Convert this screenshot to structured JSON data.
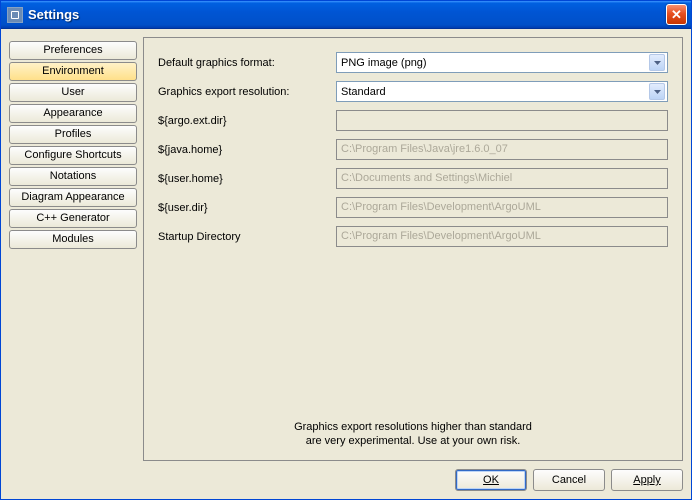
{
  "window": {
    "title": "Settings",
    "close_label": "X"
  },
  "sidebar": {
    "items": [
      {
        "label": "Preferences",
        "selected": false
      },
      {
        "label": "Environment",
        "selected": true
      },
      {
        "label": "User",
        "selected": false
      },
      {
        "label": "Appearance",
        "selected": false
      },
      {
        "label": "Profiles",
        "selected": false
      },
      {
        "label": "Configure Shortcuts",
        "selected": false
      },
      {
        "label": "Notations",
        "selected": false
      },
      {
        "label": "Diagram Appearance",
        "selected": false
      },
      {
        "label": "C++ Generator",
        "selected": false
      },
      {
        "label": "Modules",
        "selected": false
      }
    ]
  },
  "form": {
    "rows": [
      {
        "label": "Default graphics format:",
        "type": "combo",
        "value": "PNG image (png)"
      },
      {
        "label": "Graphics export resolution:",
        "type": "combo",
        "value": "Standard"
      },
      {
        "label": "${argo.ext.dir}",
        "type": "text",
        "value": ""
      },
      {
        "label": "${java.home}",
        "type": "text",
        "value": "C:\\Program Files\\Java\\jre1.6.0_07"
      },
      {
        "label": "${user.home}",
        "type": "text",
        "value": "C:\\Documents and Settings\\Michiel"
      },
      {
        "label": "${user.dir}",
        "type": "text",
        "value": "C:\\Program Files\\Development\\ArgoUML"
      },
      {
        "label": "Startup Directory",
        "type": "text",
        "value": "C:\\Program Files\\Development\\ArgoUML"
      }
    ]
  },
  "note": {
    "line1": "Graphics export resolutions higher than standard",
    "line2": "are very experimental. Use at your own risk."
  },
  "buttons": {
    "ok": "OK",
    "cancel": "Cancel",
    "apply": "Apply"
  }
}
